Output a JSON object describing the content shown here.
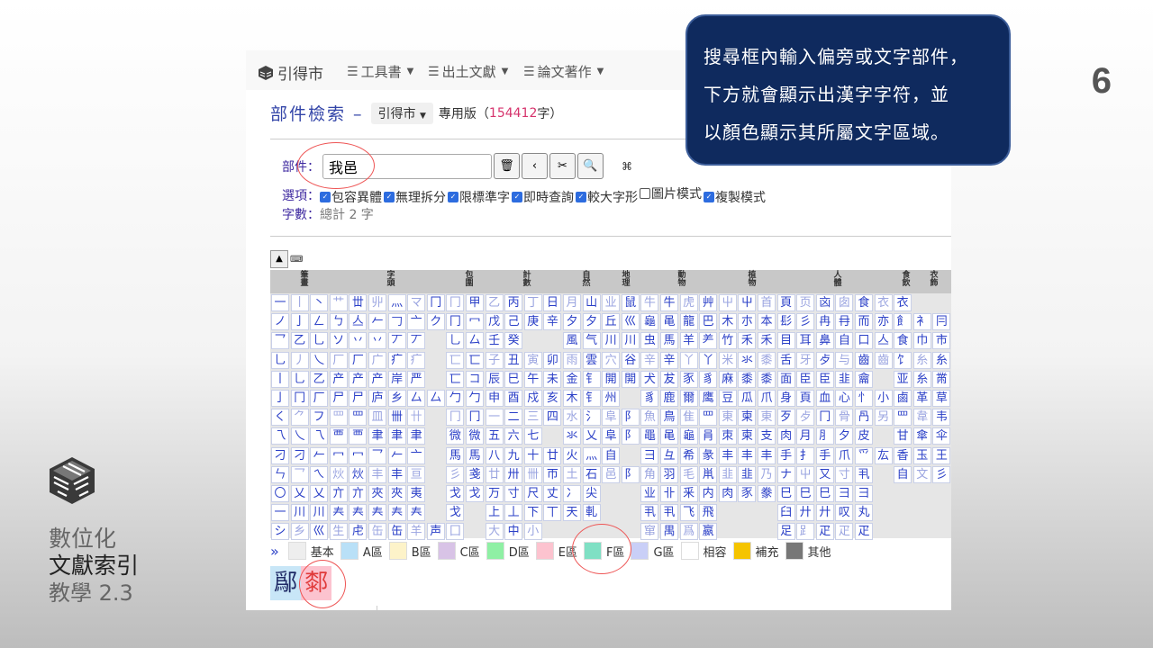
{
  "slide": {
    "title_line1": "數位化",
    "title_line2": "文獻索引",
    "title_line3": "教學 2.3",
    "page_number": "6",
    "callout_lines": [
      "搜尋框內輸入偏旁或文字部件，",
      "下方就會顯示出漢字字符，並",
      "以顏色顯示其所屬文字區域。"
    ]
  },
  "navbar": {
    "brand": "引得市",
    "items": [
      "工具書",
      "出土文獻",
      "論文著作"
    ]
  },
  "header": {
    "title": "部件檢索 –",
    "version_dropdown": "引得市",
    "edition_prefix": "專用版（",
    "count": "154412",
    "edition_suffix": "字）"
  },
  "search": {
    "label": "部件：",
    "value": "我邑",
    "buttons": [
      "🗑",
      "‹",
      "✂",
      "🔍"
    ],
    "cmd_symbol": "⌘"
  },
  "options": {
    "label": "選項：",
    "items": [
      {
        "label": "包容異體",
        "checked": true
      },
      {
        "label": "無理拆分",
        "checked": true
      },
      {
        "label": "限標準字",
        "checked": true
      },
      {
        "label": "即時查詢",
        "checked": true
      },
      {
        "label": "較大字形",
        "checked": true
      },
      {
        "label": "圖片模式",
        "checked": false
      },
      {
        "label": "複製模式",
        "checked": true
      }
    ]
  },
  "count_row": {
    "label": "字數：",
    "value": "總計 2 字"
  },
  "grid": {
    "categories": [
      "筆畫",
      "字頭",
      "包圍",
      "計數",
      "自然",
      "地理",
      "動物",
      "植物",
      "人體",
      "食飲",
      "衣飾"
    ],
    "rows": [
      [
        "一",
        "丨",
        "丶",
        "艹",
        "丗",
        "丱",
        "灬",
        "マ",
        "冂",
        "冂",
        "甲",
        "乙",
        "丙",
        "丁",
        "日",
        "月",
        "山",
        "业",
        "鼠",
        "牛",
        "牛",
        "虎",
        "艸",
        "屮",
        "屮",
        "首",
        "頁",
        "页",
        "㐫",
        "囱",
        "食",
        "衣",
        "衣"
      ],
      [
        "ノ",
        "亅",
        "ㄥ",
        "ㄅ",
        "亼",
        "𠂉",
        "𠃌",
        "亠",
        "ク",
        "冂",
        "冖",
        "戊",
        "己",
        "庚",
        "辛",
        "夕",
        "夕",
        "丘",
        "巛",
        "龜",
        "黾",
        "龍",
        "巴",
        "木",
        "朩",
        "本",
        "髟",
        "彡",
        "冉",
        "冄",
        "而",
        "亦",
        "飠",
        "衤",
        "冃"
      ],
      [
        "乛",
        "乙",
        "乚",
        "ソ",
        "丷",
        "丷",
        "丆",
        "丆",
        "",
        "乚",
        "厶",
        "壬",
        "癸",
        "",
        "",
        "風",
        "气",
        "川",
        "川",
        "虫",
        "馬",
        "羊",
        "⺶",
        "竹",
        "禾",
        "禾",
        "目",
        "耳",
        "鼻",
        "自",
        "口",
        "亼",
        "食",
        "巾",
        "市"
      ],
      [
        "乚",
        "丿",
        "乀",
        "厂",
        "厂",
        "广",
        "疒",
        "疒",
        "",
        "匸",
        "匸",
        "子",
        "丑",
        "寅",
        "卯",
        "雨",
        "雲",
        "穴",
        "谷",
        "辛",
        "辛",
        "丫",
        "丫",
        "米",
        "氺",
        "黍",
        "舌",
        "牙",
        "歺",
        "与",
        "齒",
        "齒",
        "饣",
        "糸",
        "糸"
      ],
      [
        "丨",
        "乚",
        "乙",
        "产",
        "产",
        "产",
        "岸",
        "严",
        "",
        "匸",
        "コ",
        "辰",
        "巳",
        "午",
        "未",
        "金",
        "钅",
        "開",
        "開",
        "犬",
        "犮",
        "豕",
        "豸",
        "麻",
        "黍",
        "黍",
        "面",
        "臣",
        "臣",
        "韭",
        "龠",
        "",
        "亚",
        "糸",
        "黹"
      ],
      [
        "亅",
        "冂",
        "厂",
        "尸",
        "尸",
        "庐",
        "乡",
        "厶",
        "厶",
        "勹",
        "勹",
        "申",
        "酉",
        "戍",
        "亥",
        "木",
        "钅",
        "州",
        "",
        "豸",
        "鹿",
        "爾",
        "鹰",
        "豆",
        "瓜",
        "爪",
        "身",
        "頁",
        "血",
        "心",
        "忄",
        "小",
        "鹵",
        "革",
        "草"
      ],
      [
        "く",
        "⺈",
        "フ",
        "罒",
        "罒",
        "皿",
        "卌",
        "卄",
        "",
        "冂",
        "冂",
        "一",
        "二",
        "三",
        "四",
        "水",
        "氵",
        "阜",
        "阝",
        "魚",
        "鳥",
        "隹",
        "罒",
        "東",
        "柬",
        "東",
        "歹",
        "歺",
        "冂",
        "骨",
        "冎",
        "另",
        "罒",
        "韋",
        "韦"
      ],
      [
        "乁",
        "乀",
        "乁",
        "覀",
        "覀",
        "聿",
        "聿",
        "聿",
        "",
        "微",
        "微",
        "五",
        "六",
        "七",
        "",
        "氺",
        "乂",
        "阜",
        "阝",
        "黽",
        "黾",
        "龜",
        "肙",
        "朿",
        "柬",
        "支",
        "肉",
        "月",
        "⺼",
        "夕",
        "皮",
        "",
        "甘",
        "傘",
        "伞"
      ],
      [
        "刁",
        "刁",
        "𠂉",
        "冖",
        "冖",
        "乛",
        "𠂉",
        "亠",
        "",
        "馬",
        "馬",
        "八",
        "九",
        "十",
        "廿",
        "火",
        "灬",
        "自",
        "",
        "彐",
        "彑",
        "希",
        "彖",
        "丰",
        "丰",
        "丰",
        "手",
        "扌",
        "手",
        "爪",
        "爫",
        "厷",
        "香",
        "玉",
        "王"
      ],
      [
        "ㄣ",
        "乛",
        "ㄟ",
        "炏",
        "炏",
        "丰",
        "丰",
        "亘",
        "",
        "彡",
        "戔",
        "廿",
        "卅",
        "卌",
        "帀",
        "土",
        "石",
        "邑",
        "阝",
        "角",
        "羽",
        "毛",
        "鼡",
        "韭",
        "韭",
        "乃",
        "ナ",
        "屮",
        "又",
        "寸",
        "丮",
        "",
        "自",
        "文",
        "彡"
      ],
      [
        "〇",
        "乂",
        "乂",
        "亣",
        "亣",
        "夾",
        "夾",
        "夷",
        "",
        "戈",
        "戈",
        "万",
        "寸",
        "尺",
        "丈",
        "冫",
        "尖",
        "",
        "",
        "业",
        "卝",
        "釆",
        "内",
        "肉",
        "豕",
        "豢",
        "巳",
        "巳",
        "巳",
        "彐",
        "彐",
        "",
        "",
        "",
        ""
      ],
      [
        "一",
        "川",
        "川",
        "𡗗",
        "𡗗",
        "𡗗",
        "𡗗",
        "𡗗",
        "",
        "戈",
        "",
        "上",
        "丄",
        "下",
        "丅",
        "天",
        "軋",
        "",
        "",
        "丮",
        "丮",
        "飞",
        "飛",
        "",
        "",
        "",
        "臼",
        "廾",
        "廾",
        "叹",
        "丸",
        "",
        "",
        "",
        ""
      ],
      [
        "シ",
        "乡",
        "巛",
        "生",
        "虍",
        "缶",
        "缶",
        "羊",
        "声",
        "囗",
        "",
        "大",
        "中",
        "小",
        "",
        "",
        "",
        "",
        "",
        "窜",
        "禺",
        "爲",
        "嬴",
        "",
        "",
        "",
        "足",
        "𧾷",
        "疋",
        "疋",
        "疋",
        "",
        "",
        "",
        ""
      ]
    ]
  },
  "legend": {
    "more": "»",
    "items": [
      {
        "label": "基本",
        "color": "#eeeeee"
      },
      {
        "label": "A區",
        "color": "#b9e0f7"
      },
      {
        "label": "B區",
        "color": "#fdf3c9"
      },
      {
        "label": "C區",
        "color": "#d8c3e6"
      },
      {
        "label": "D區",
        "color": "#8ff0a4"
      },
      {
        "label": "E區",
        "color": "#fcc3cf"
      },
      {
        "label": "F區",
        "color": "#7fe0c4"
      },
      {
        "label": "G區",
        "color": "#c9cff7"
      },
      {
        "label": "相容",
        "color": "#ffffff"
      },
      {
        "label": "補充",
        "color": "#f5c400"
      },
      {
        "label": "其他",
        "color": "#777777"
      }
    ]
  },
  "results": [
    {
      "char": "鄬",
      "zone": "A區"
    },
    {
      "char": "䣛",
      "zone": "E區"
    }
  ]
}
